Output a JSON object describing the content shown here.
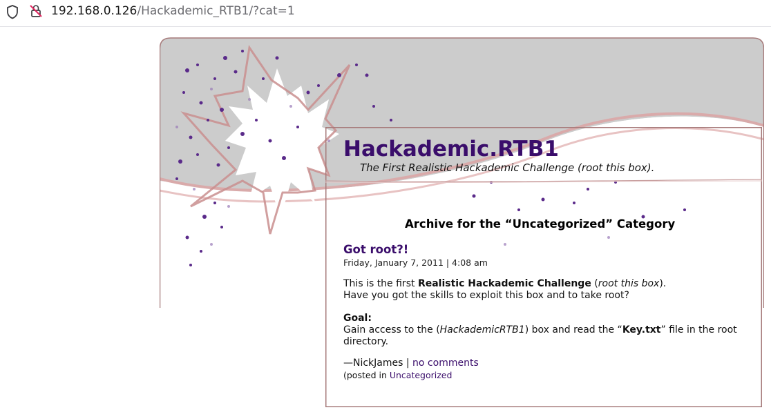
{
  "browser": {
    "url_host": "192.168.0.126",
    "url_path": "/Hackademic_RTB1/?cat=1"
  },
  "blog": {
    "title": "Hackademic.RTB1",
    "tagline": "The First Realistic Hackademic Challenge (root this box)."
  },
  "archive": {
    "heading": "Archive for the “Uncategorized” Category"
  },
  "post": {
    "title": "Got root?!",
    "date": "Friday, January 7, 2011 | 4:08 am",
    "para1": {
      "lead": "This is the first ",
      "bold": "Realistic Hackademic Challenge",
      "mid": " (",
      "italic": "root this box",
      "end": ")."
    },
    "para2": "Have you got the skills to exploit this box and to take root?",
    "goal_label": "Goal:",
    "goal_line1": {
      "lead": "Gain access to the (",
      "italic": "HackademicRTB1",
      "mid": ") box and read the “",
      "bold": "Key.txt",
      "end": "” file in the root"
    },
    "goal_line2": "directory.",
    "author": "—NickJames",
    "separator": " | ",
    "comments_link": "no comments",
    "posted_in_prefix": "(posted in ",
    "category_link": "Uncategorized"
  },
  "colors": {
    "title_purple": "#3a0d6b",
    "border_brown": "#a67a7a",
    "header_gray": "#cccccc"
  }
}
